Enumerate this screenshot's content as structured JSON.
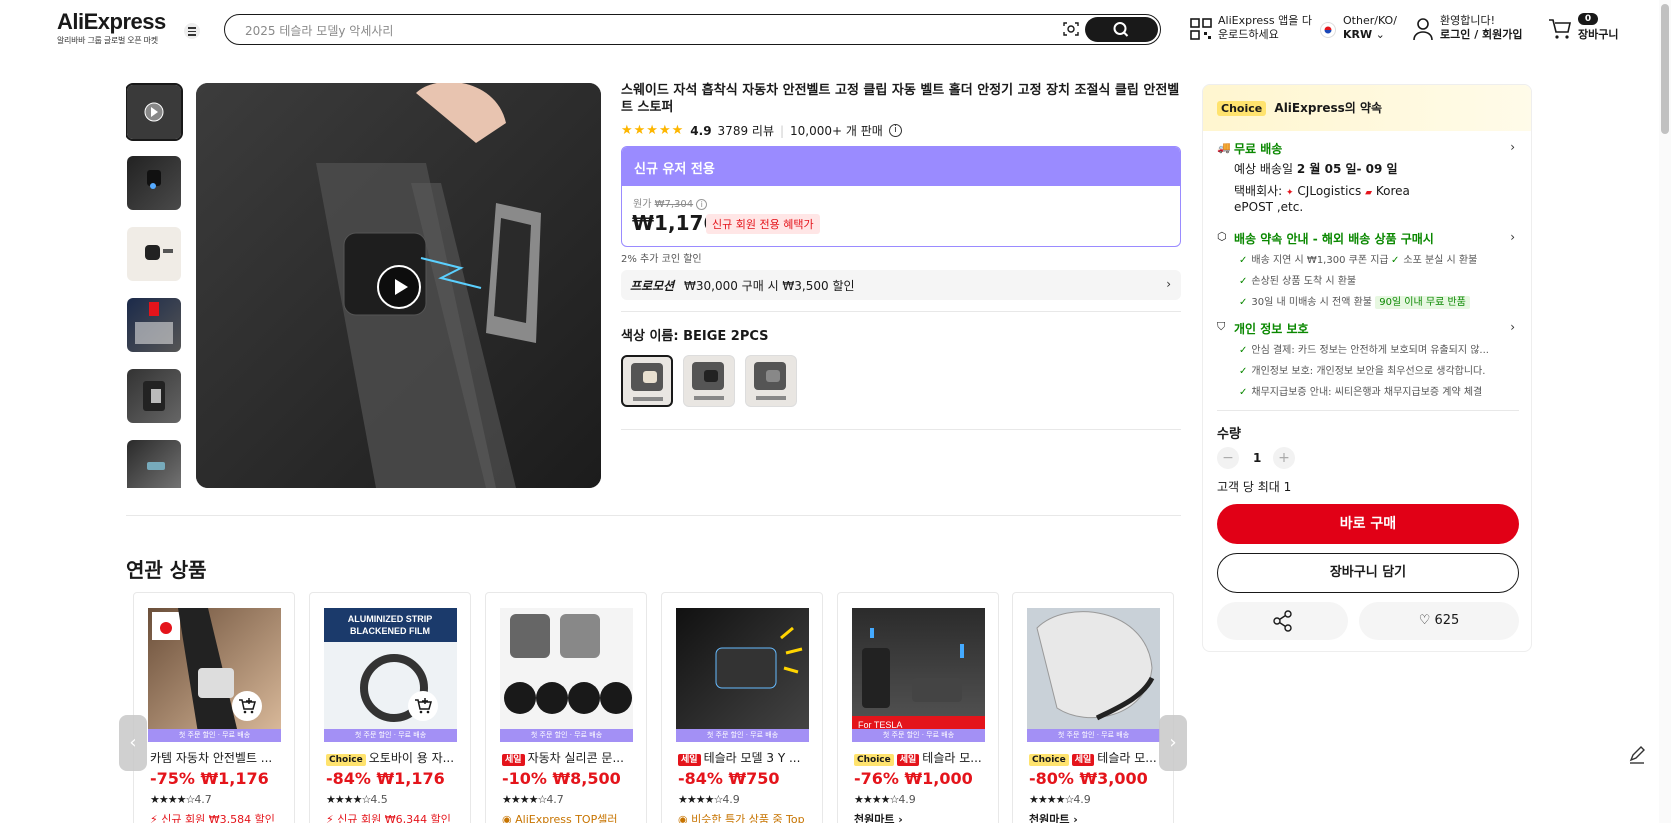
{
  "header": {
    "logo": "AliExpress",
    "logo_tagline": "알리바바 그룹 글로벌 오픈 마켓",
    "search_placeholder": "2025 테슬라 모델y 악세사리",
    "app_line1": "AliExpress 앱을 다",
    "app_line2": "운로드하세요",
    "region_line1": "Other/KO/",
    "region_line2": "KRW",
    "account_line1": "환영합니다!",
    "account_line2": "로그인 / 회원가입",
    "cart_count": "0",
    "cart_label": "장바구니"
  },
  "product": {
    "title": "스웨이드 자석 흡착식 자동차 안전벨트 고정 클립 자동 벨트 홀더 안정기 고정 장치 조절식 클립 안전벨트 스토퍼",
    "rating": "4.9",
    "reviews": "3789 리뷰",
    "sold": "10,000+ 개 판매",
    "promo_header": "신규 유저 전용",
    "original_label": "원가",
    "original_price": "₩7,304",
    "price": "₩1,176",
    "promo_tag": "신규 회원 전용 혜택가",
    "coin_text": "2% 추가 코인 할인",
    "promotion_label": "프로모션",
    "promotion_text": "₩30,000 구매 시 ₩3,500 할인",
    "color_label": "색상 이름: BEIGE 2PCS",
    "swatches": [
      "BEIGE 2PCS",
      "BLACK 2PCS",
      "GRAY 2PCS"
    ]
  },
  "related": {
    "title": "연관 상품",
    "strip_text": "첫 주문 할인 · 무료 배송",
    "items": [
      {
        "name": "카템 자동차 안전벨트 ...",
        "tag": "",
        "discount": "-75%",
        "price": "₩1,176",
        "stars": "★★★★☆",
        "rating": "4.7",
        "foot": "신규 회원 ₩3,584 할인"
      },
      {
        "name": "오토바이 용 자...",
        "tag": "Choice",
        "discount": "-84%",
        "price": "₩1,176",
        "stars": "★★★★☆",
        "rating": "4.5",
        "foot": "신규 회원 ₩6,344 할인"
      },
      {
        "name": "자동차 실리콘 문...",
        "tag": "세일",
        "discount": "-10%",
        "price": "₩8,500",
        "stars": "★★★★☆",
        "rating": "4.7",
        "foot": "AliExpress TOP셀러"
      },
      {
        "name": "테슬라 모델 3 Y ...",
        "tag": "세일",
        "discount": "-84%",
        "price": "₩750",
        "stars": "★★★★☆",
        "rating": "4.9",
        "foot": "비슷한 특가 상품 중 Top"
      },
      {
        "name": "테슬라 모...",
        "tag": "Choice 세일",
        "discount": "-76%",
        "price": "₩1,000",
        "stars": "★★★★☆",
        "rating": "4.9",
        "foot": "천원마트 ›"
      },
      {
        "name": "테슬라 모...",
        "tag": "Choice 세일",
        "discount": "-80%",
        "price": "₩3,000",
        "stars": "★★★★☆",
        "rating": "4.9",
        "foot": "천원마트 ›"
      }
    ]
  },
  "panel": {
    "choice_badge": "Choice",
    "promise_title": "AliExpress의 약속",
    "shipping_title": "무료 배송",
    "delivery_label": "예상 배송일",
    "delivery_date": "2 월 05 일- 09 일",
    "carrier_label": "택배회사:",
    "carrier1": "CJLogistics",
    "carrier2": "Korea",
    "carrier3": "ePOST ,etc.",
    "guarantee_title": "배송 약속 안내 - 해외 배송 상품 구매시",
    "guarantee_items": [
      "배송 지연 시 ₩1,300 쿠폰 지급",
      "소포 분실 시 환불",
      "손상된 상품 도착 시 환불",
      "30일 내 미배송 시 전액 환불",
      "90일 이내 무료 반품"
    ],
    "privacy_title": "개인 정보 보호",
    "privacy_items": [
      "안심 결제: 카드 정보는 안전하게 보호되며 유출되지 않...",
      "개인정보 보호: 개인정보 보안을 최우선으로 생각합니다.",
      "채무지급보증 안내: 씨티은행과 채무지급보증 계약 체결"
    ],
    "qty_label": "수량",
    "qty_value": "1",
    "limit_text": "고객 당 최대 1",
    "buy_now": "바로 구매",
    "add_cart": "장바구니 담기",
    "wishlist_count": "625"
  }
}
